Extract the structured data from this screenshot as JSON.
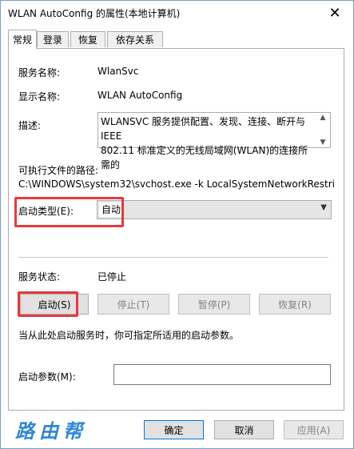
{
  "window": {
    "title": "WLAN AutoConfig 的属性(本地计算机)",
    "close_symbol": "✕"
  },
  "tabs": [
    {
      "label": "常规",
      "active": true
    },
    {
      "label": "登录",
      "active": false
    },
    {
      "label": "恢复",
      "active": false
    },
    {
      "label": "依存关系",
      "active": false
    }
  ],
  "general": {
    "service_name_label": "服务名称:",
    "service_name_value": "WlanSvc",
    "display_name_label": "显示名称:",
    "display_name_value": "WLAN AutoConfig",
    "description_label": "描述:",
    "description_value": "WLANSVC 服务提供配置、发现、连接、断开与 IEEE\n802.11 标准定义的无线局域网(WLAN)的连接所需的",
    "path_label": "可执行文件的路径:",
    "path_value": "C:\\WINDOWS\\system32\\svchost.exe -k LocalSystemNetworkRestricted -",
    "startup_type_label": "启动类型(E):",
    "startup_type_value": "自动",
    "service_status_label": "服务状态:",
    "service_status_value": "已停止",
    "start_button": "启动(S)",
    "stop_button": "停止(T)",
    "pause_button": "暂停(P)",
    "resume_button": "恢复(R)",
    "hint_text": "当从此处启动服务时，你可指定所适用的启动参数。",
    "start_params_label": "启动参数(M):",
    "start_params_value": ""
  },
  "footer": {
    "ok_button": "确定",
    "cancel_button": "取消",
    "apply_button": "应用(A)"
  },
  "watermark": "路由帮",
  "colors": {
    "highlight": "#e8383d",
    "watermark": "#2f86d6",
    "window_border": "#7a9cc6"
  }
}
